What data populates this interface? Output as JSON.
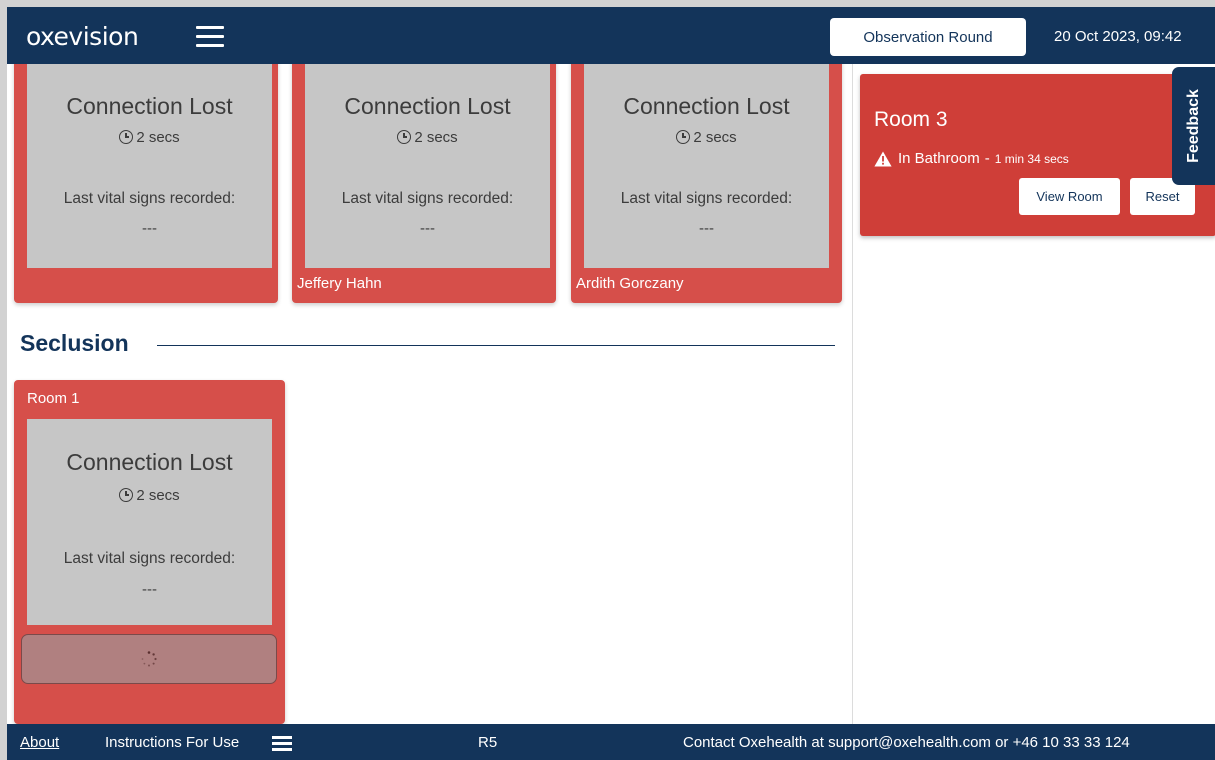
{
  "header": {
    "logo": "oxevision",
    "observation_button": "Observation Round",
    "datetime": "20 Oct 2023, 09:42"
  },
  "top_cards": [
    {
      "title": "Connection Lost",
      "time": "2 secs",
      "last_label": "Last vital signs recorded:",
      "last_value": "---",
      "name": ""
    },
    {
      "title": "Connection Lost",
      "time": "2 secs",
      "last_label": "Last vital signs recorded:",
      "last_value": "---",
      "name": "Jeffery Hahn"
    },
    {
      "title": "Connection Lost",
      "time": "2 secs",
      "last_label": "Last vital signs recorded:",
      "last_value": "---",
      "name": "Ardith Gorczany"
    }
  ],
  "seclusion": {
    "title": "Seclusion",
    "card": {
      "room": "Room 1",
      "title": "Connection Lost",
      "time": "2 secs",
      "last_label": "Last vital signs recorded:",
      "last_value": "---"
    }
  },
  "alert": {
    "room": "Room 3",
    "status": "In Bathroom",
    "separator": "-",
    "duration": "1 min 34 secs",
    "view_button": "View Room",
    "reset_button": "Reset"
  },
  "feedback_label": "Feedback",
  "footer": {
    "about": "About",
    "instructions": "Instructions For Use",
    "version": "R5",
    "contact": "Contact Oxehealth at support@oxehealth.com or +46 10 33 33 124"
  },
  "colors": {
    "navy": "#13345a",
    "card_red": "#d64f4a",
    "alert_red": "#cf3e38",
    "card_grey": "#c6c6c6"
  }
}
